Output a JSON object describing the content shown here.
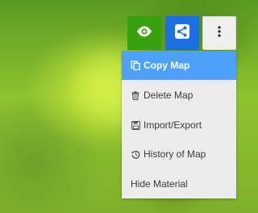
{
  "toolbar": {
    "view_icon": "eye-icon",
    "share_icon": "share-icon",
    "more_icon": "kebab-menu-icon",
    "colors": {
      "view": "#3aa10e",
      "share": "#1b6fe0",
      "more": "#efefef"
    }
  },
  "menu": {
    "accent": "#4ea0f8",
    "items": [
      {
        "label": "Copy Map",
        "icon": "copy-icon",
        "active": true
      },
      {
        "label": "Delete Map",
        "icon": "trash-icon",
        "active": false
      },
      {
        "label": "Import/Export",
        "icon": "save-icon",
        "active": false
      },
      {
        "label": "History of Map",
        "icon": "history-icon",
        "active": false
      },
      {
        "label": "Hide Material",
        "icon": "",
        "active": false
      }
    ]
  }
}
